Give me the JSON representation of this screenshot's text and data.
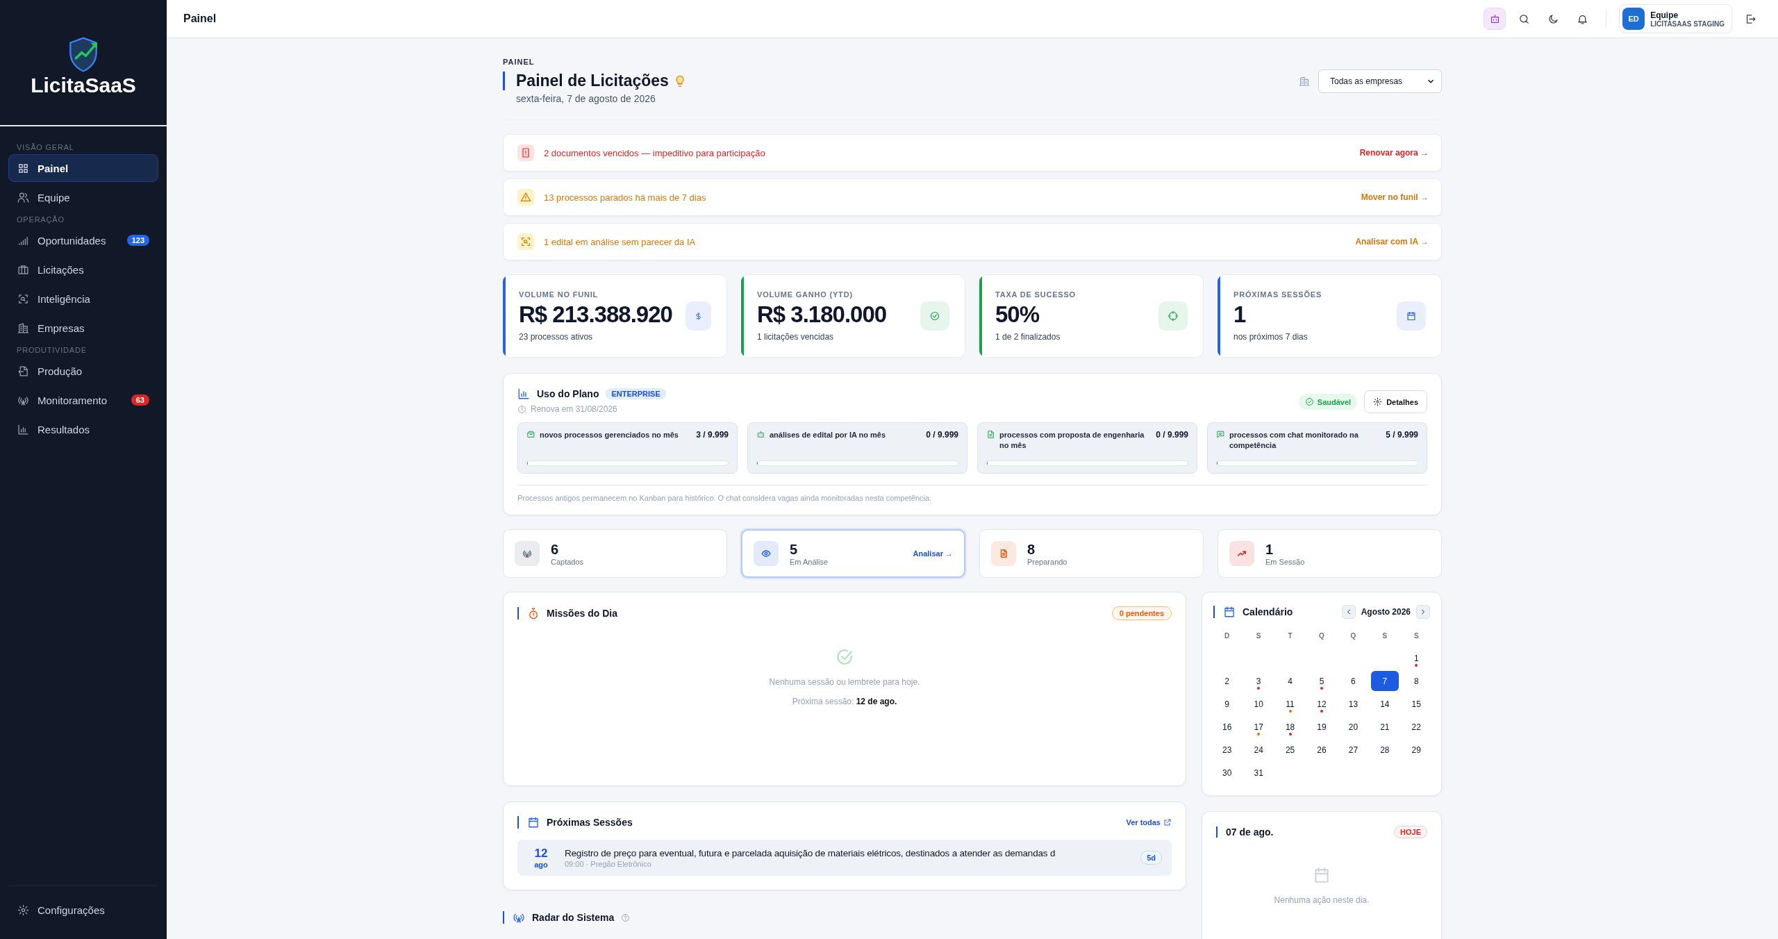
{
  "sidebar": {
    "logo": "LicitaSaaS",
    "sections": [
      {
        "title": "VISÃO GERAL",
        "items": [
          {
            "label": "Painel",
            "selected": true
          },
          {
            "label": "Equipe",
            "selected": false
          }
        ]
      },
      {
        "title": "OPERAÇÃO",
        "items": [
          {
            "label": "Oportunidades",
            "selected": false,
            "badge": "123",
            "color": "#2563eb"
          },
          {
            "label": "Licitações",
            "selected": false
          },
          {
            "label": "Inteligência",
            "selected": false
          },
          {
            "label": "Empresas",
            "selected": false
          }
        ]
      },
      {
        "title": "PRODUTIVIDADE",
        "items": [
          {
            "label": "Produção",
            "selected": false
          },
          {
            "label": "Monitoramento",
            "selected": false,
            "badge": "63",
            "color": "#dc2626"
          },
          {
            "label": "Resultados",
            "selected": false
          }
        ]
      }
    ],
    "footer_item": {
      "label": "Configurações"
    }
  },
  "header": {
    "title": "Painel",
    "user": {
      "initials": "ED",
      "name": "Equipe",
      "org": "LICITASAAS STAGING"
    }
  },
  "page": {
    "eyebrow": "PAINEL",
    "title": "Painel de Licitações",
    "date": "sexta-feira, 7 de agosto de 2026",
    "company_select": {
      "value": "Todas as empresas"
    }
  },
  "alerts": [
    {
      "kind": "danger",
      "text": "2 documentos vencidos — impeditivo para participação",
      "action": "Renovar agora →"
    },
    {
      "kind": "warning",
      "text": "13 processos parados há mais de 7 dias",
      "action": "Mover no funil →"
    },
    {
      "kind": "warning",
      "text": "1 edital em análise sem parecer da IA",
      "action": "Analisar com IA →"
    }
  ],
  "kpis": [
    {
      "label": "VOLUME NO FUNIL",
      "value": "R$ 213.388.920",
      "note": "23 processos ativos",
      "color": "#2563eb"
    },
    {
      "label": "VOLUME GANHO (YTD)",
      "value": "R$ 3.180.000",
      "note": "1 licitações vencidas",
      "color": "#16a34a"
    },
    {
      "label": "TAXA DE SUCESSO",
      "value": "50%",
      "note": "1 de 2 finalizados",
      "color": "#16a34a"
    },
    {
      "label": "PRÓXIMAS SESSÕES",
      "value": "1",
      "note": "nos próximos 7 dias",
      "color": "#2563eb"
    }
  ],
  "plan": {
    "title": "Uso do Plano",
    "tier": "ENTERPRISE",
    "renews": "Renova em 31/08/2026",
    "status": "Saudável",
    "details_button": "Detalhes",
    "usage": [
      {
        "label": "novos processos gerenciados no mês",
        "reading": "3 / 9.999",
        "level": 0.0003
      },
      {
        "label": "análises de edital por IA no mês",
        "reading": "0 / 9.999",
        "level": 0
      },
      {
        "label": "processos com proposta de engenharia no mês",
        "reading": "0 / 9.999",
        "level": 0
      },
      {
        "label": "processos com chat monitorado na competência",
        "reading": "5 / 9.999",
        "level": 0.0005
      }
    ],
    "footnote": "Processos antigos permanecem no Kanban para histórico. O chat considera vagas ainda monitoradas nesta competência."
  },
  "stages": [
    {
      "count": "6",
      "label": "Captados",
      "color": "#6b7280",
      "selected": false
    },
    {
      "count": "5",
      "label": "Em Análise",
      "color": "#2563eb",
      "selected": true,
      "action": "Analisar →"
    },
    {
      "count": "8",
      "label": "Preparando",
      "color": "#ea580c",
      "selected": false
    },
    {
      "count": "1",
      "label": "Em Sessão",
      "color": "#dc2626",
      "selected": false
    }
  ],
  "missions": {
    "title": "Missões do Dia",
    "badge": "0 pendentes",
    "empty": "Nenhuma sessão ou lembrete para hoje.",
    "next": "Próxima sessão: **12 de ago.**"
  },
  "calendar": {
    "title": "Calendário",
    "month": "Agosto 2026",
    "weekdays": [
      "D",
      "S",
      "T",
      "Q",
      "Q",
      "S",
      "S"
    ],
    "weeks": [
      [
        {
          "day": "1",
          "selected": false,
          "color": "#dc2626"
        }
      ],
      [
        {
          "day": "2",
          "selected": false
        },
        {
          "day": "3",
          "selected": false,
          "color": "#dc2626"
        },
        {
          "day": "4",
          "selected": false
        },
        {
          "day": "5",
          "selected": false,
          "color": "#dc2626"
        },
        {
          "day": "6",
          "selected": false
        },
        {
          "day": "7",
          "selected": true
        },
        {
          "day": "8",
          "selected": false
        }
      ],
      [
        {
          "day": "9",
          "selected": false
        },
        {
          "day": "10",
          "selected": false
        },
        {
          "day": "11",
          "selected": false,
          "color": "#d97706"
        },
        {
          "day": "12",
          "selected": false,
          "color": "#dc2626"
        },
        {
          "day": "13",
          "selected": false
        },
        {
          "day": "14",
          "selected": false
        },
        {
          "day": "15",
          "selected": false
        }
      ],
      [
        {
          "day": "16",
          "selected": false
        },
        {
          "day": "17",
          "selected": false,
          "color": "#d97706"
        },
        {
          "day": "18",
          "selected": false,
          "color": "#dc2626"
        },
        {
          "day": "19",
          "selected": false
        },
        {
          "day": "20",
          "selected": false
        },
        {
          "day": "21",
          "selected": false
        },
        {
          "day": "22",
          "selected": false
        }
      ],
      [
        {
          "day": "23",
          "selected": false
        },
        {
          "day": "24",
          "selected": false
        },
        {
          "day": "25",
          "selected": false
        },
        {
          "day": "26",
          "selected": false
        },
        {
          "day": "27",
          "selected": false
        },
        {
          "day": "28",
          "selected": false
        },
        {
          "day": "29",
          "selected": false
        }
      ],
      [
        {
          "day": "30",
          "selected": false
        },
        {
          "day": "31",
          "selected": false
        }
      ]
    ]
  },
  "upcoming": {
    "title": "Próximas Sessões",
    "link": "Ver todas",
    "sessions": [
      {
        "day": "12",
        "month": "ago",
        "title": "Registro de preço para eventual, futura e parcelada aquisição de materiais elétricos, destinados a atender as demandas d",
        "meta": "09:00 · Pregão Eletrônico",
        "badge": "5d"
      }
    ]
  },
  "day_panel": {
    "title": "07 de ago.",
    "badge": "HOJE",
    "empty": "Nenhuma ação neste dia."
  },
  "radar": {
    "title": "Radar do Sistema"
  }
}
